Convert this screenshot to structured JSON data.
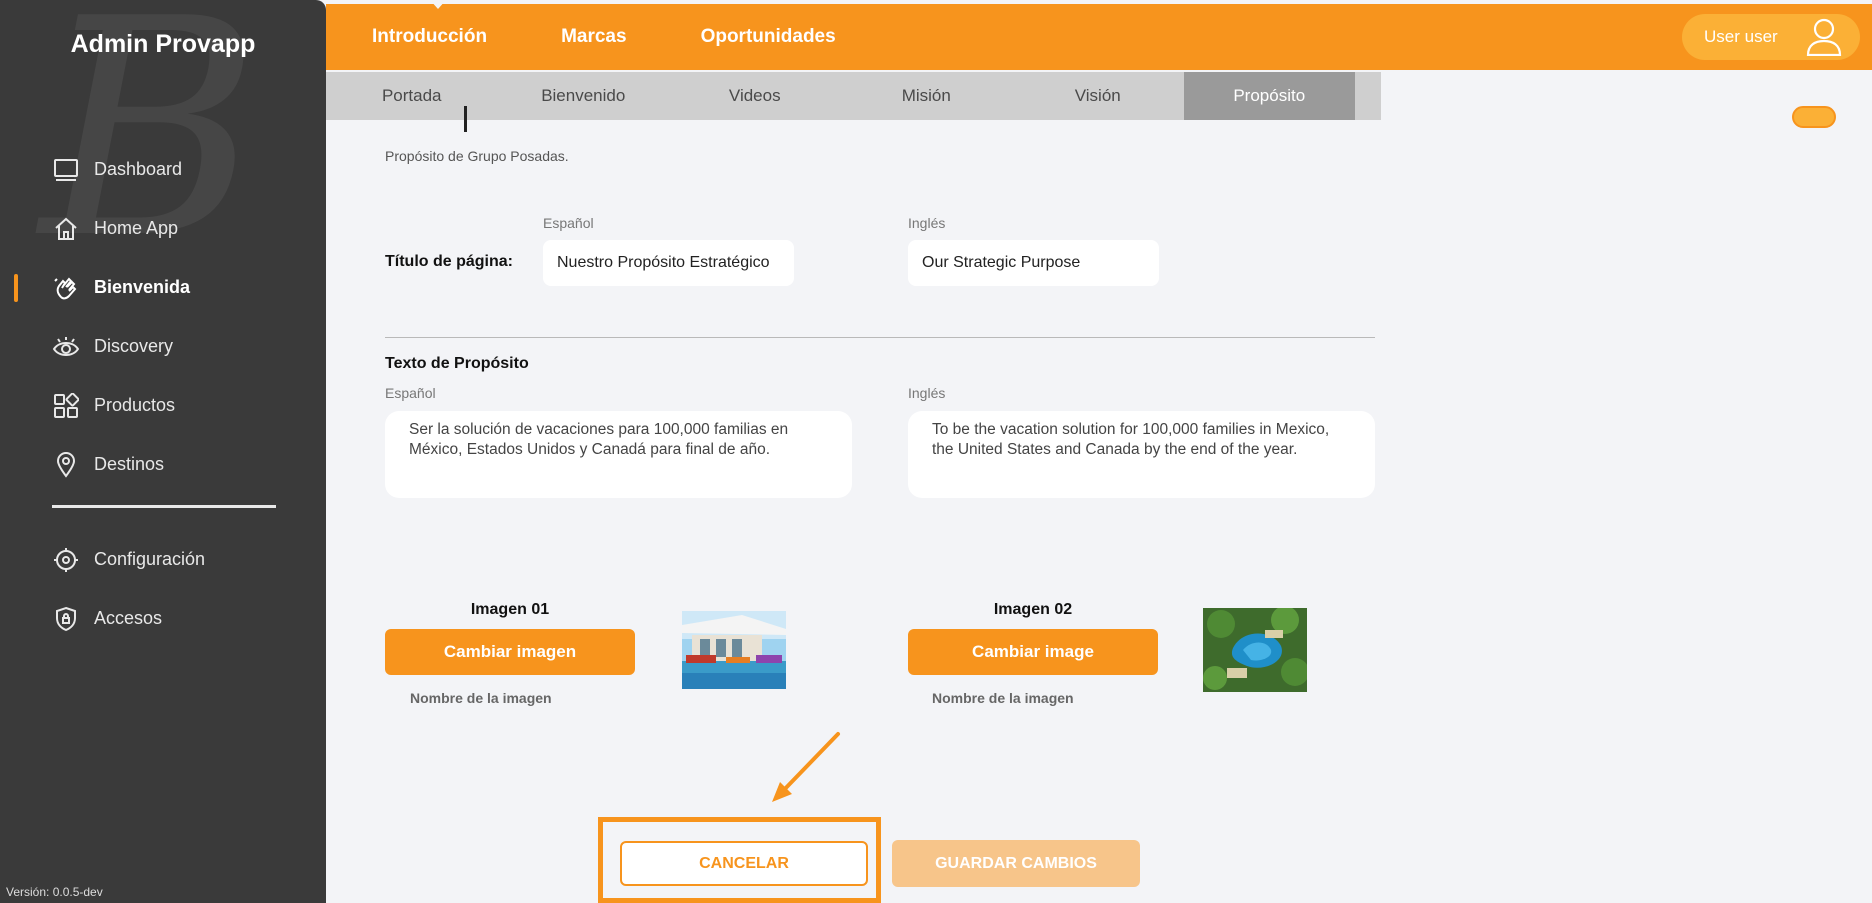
{
  "sidebar": {
    "app_title": "Admin Provapp",
    "items": [
      {
        "label": "Dashboard",
        "icon": "monitor-icon"
      },
      {
        "label": "Home App",
        "icon": "home-icon"
      },
      {
        "label": "Bienvenida",
        "icon": "wave-hand-icon",
        "active": true
      },
      {
        "label": "Discovery",
        "icon": "eye-icon"
      },
      {
        "label": "Productos",
        "icon": "grid-icon"
      },
      {
        "label": "Destinos",
        "icon": "map-pin-icon"
      }
    ],
    "items2": [
      {
        "label": "Configuración",
        "icon": "gear-icon"
      },
      {
        "label": "Accesos",
        "icon": "shield-icon"
      }
    ],
    "version": "Versión: 0.0.5-dev"
  },
  "topbar": {
    "nav": [
      "Introducción",
      "Marcas",
      "Oportunidades"
    ],
    "user_label": "User user"
  },
  "subtabs": [
    "Portada",
    "Bienvenido",
    "Videos",
    "Misión",
    "Visión",
    "Propósito"
  ],
  "active_subtab": "Propósito",
  "main": {
    "description": "Propósito de Grupo Posadas.",
    "title_row": {
      "label": "Título de página:",
      "es_label": "Español",
      "en_label": "Inglés",
      "es_value": "Nuestro Propósito Estratégico",
      "en_value": "Our Strategic Purpose"
    },
    "text_section": {
      "label": "Texto de Propósito",
      "es_label": "Español",
      "en_label": "Inglés",
      "es_value": "Ser la solución de vacaciones para 100,000 familias en México, Estados Unidos y Canadá para final de año.",
      "en_value": "To be the vacation solution for 100,000 families in Mexico, the United States and Canada by the end of the year."
    },
    "images": [
      {
        "label": "Imagen 01",
        "button": "Cambiar imagen",
        "name_label": "Nombre de la imagen"
      },
      {
        "label": "Imagen 02",
        "button": "Cambiar image",
        "name_label": "Nombre de la imagen"
      }
    ],
    "cancel_label": "CANCELAR",
    "save_label": "GUARDAR CAMBIOS"
  },
  "colors": {
    "accent": "#f7941d",
    "sidebar_bg": "#3a3a3a",
    "background": "#f3f4f7"
  }
}
